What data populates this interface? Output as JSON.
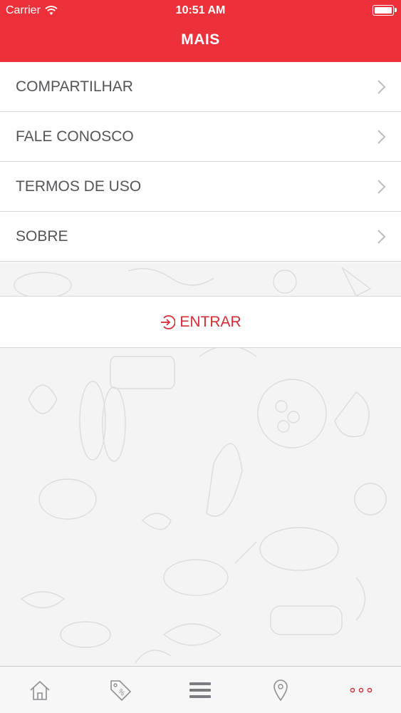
{
  "status_bar": {
    "carrier": "Carrier",
    "time": "10:51 AM"
  },
  "header": {
    "title": "MAIS"
  },
  "menu": {
    "items": [
      {
        "label": "COMPARTILHAR"
      },
      {
        "label": "FALE CONOSCO"
      },
      {
        "label": "TERMOS DE USO"
      },
      {
        "label": "SOBRE"
      }
    ]
  },
  "login": {
    "label": "ENTRAR"
  },
  "tab_bar": {
    "tabs": [
      {
        "icon": "home-icon"
      },
      {
        "icon": "tag-percent-icon"
      },
      {
        "icon": "menu-icon"
      },
      {
        "icon": "location-pin-icon"
      },
      {
        "icon": "more-dots-icon",
        "active": true
      }
    ]
  },
  "colors": {
    "brand_red": "#ec313a",
    "enter_red": "#d32d36",
    "text_gray": "#555559"
  }
}
